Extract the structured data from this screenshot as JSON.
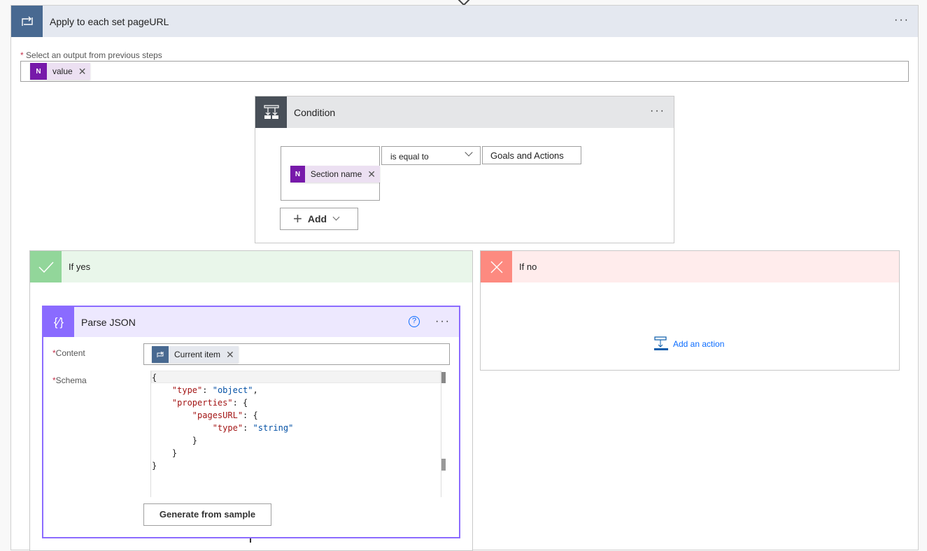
{
  "apply_each": {
    "title": "Apply to each set pageURL",
    "output_label": "Select an output from previous steps",
    "token": "value"
  },
  "condition": {
    "title": "Condition",
    "left_token": "Section name",
    "operator": "is equal to",
    "value": "Goals and Actions",
    "add_label": "Add"
  },
  "if_yes": {
    "title": "If yes"
  },
  "if_no": {
    "title": "If no",
    "add_action": "Add an action"
  },
  "parse_json": {
    "title": "Parse JSON",
    "content_label": "Content",
    "content_token": "Current item",
    "schema_label": "Schema",
    "schema_lines": [
      "{",
      "    \"type\": \"object\",",
      "    \"properties\": {",
      "        \"pagesURL\": {",
      "            \"type\": \"string\"",
      "        }",
      "    }",
      "}"
    ],
    "generate_label": "Generate from sample"
  },
  "colors": {
    "apply_each": "#486991",
    "condition": "#484f58",
    "yes": "#92d69a",
    "no": "#fd8a80",
    "parse_json": "#8a6bff",
    "onenote": "#7719aa",
    "link": "#0b6cff"
  }
}
